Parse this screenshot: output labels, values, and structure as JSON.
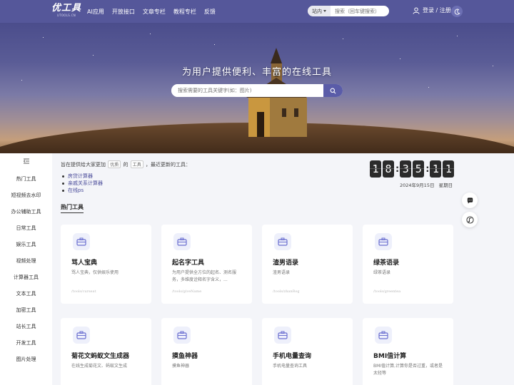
{
  "header": {
    "logo_text": "优工具",
    "logo_sub": "UTOOLS.CN",
    "nav": [
      "AI应用",
      "开放接口",
      "文章专栏",
      "教程专栏",
      "反馈"
    ],
    "search_scope": "站内",
    "search_placeholder": "搜索（回车键搜索）",
    "login_label": "登录 / 注册"
  },
  "hero": {
    "title": "为用户提供便利、丰富的在线工具",
    "search_placeholder": "搜索需要的工具关键字(如：图片)"
  },
  "sidebar": {
    "items": [
      "热门工具",
      "短视频去水印",
      "办公辅助工具",
      "日常工具",
      "娱乐工具",
      "视频处理",
      "计算器工具",
      "文本工具",
      "加密工具",
      "站长工具",
      "开发工具",
      "图片处理"
    ]
  },
  "intro": {
    "prefix": "旨在提供给大家更加",
    "tag1": "优质",
    "middle": "的",
    "tag2": "工具",
    "suffix": "，最近更新的工具："
  },
  "updates": [
    "房贷计算器",
    "亲戚关系计算器",
    "在线ps"
  ],
  "clock": {
    "digits": [
      "1",
      "8",
      "3",
      "5",
      "1",
      "1"
    ],
    "date": "2024年9月15日",
    "weekday": "星期日"
  },
  "section_title": "热门工具",
  "cards": [
    {
      "title": "骂人宝典",
      "desc": "骂人宝典，仅供娱乐使用",
      "path": "/tools/curseat"
    },
    {
      "title": "起名字工具",
      "desc": "为用户提供全方位的起名、测名服务，多维度诠释名字含义，...",
      "path": "/tools/giveName"
    },
    {
      "title": "渣男语录",
      "desc": "渣男语录",
      "path": "/tools/zhanRog"
    },
    {
      "title": "绿茶语录",
      "desc": "绿茶语录",
      "path": "/tools/greentea"
    },
    {
      "title": "菊花文蚂蚁文生成器",
      "desc": "在线生成菊花文、蚂蚁文生成",
      "path": ""
    },
    {
      "title": "摸鱼神器",
      "desc": "摸鱼神器",
      "path": ""
    },
    {
      "title": "手机电量查询",
      "desc": "手机电量查询工具",
      "path": ""
    },
    {
      "title": "BMI值计算",
      "desc": "BMI值计算,计算你是否过重，或者是太轻等",
      "path": ""
    }
  ],
  "colors": {
    "header_bg": "#55579a",
    "accent": "#5a5ca8",
    "link": "#4a4c9a"
  }
}
